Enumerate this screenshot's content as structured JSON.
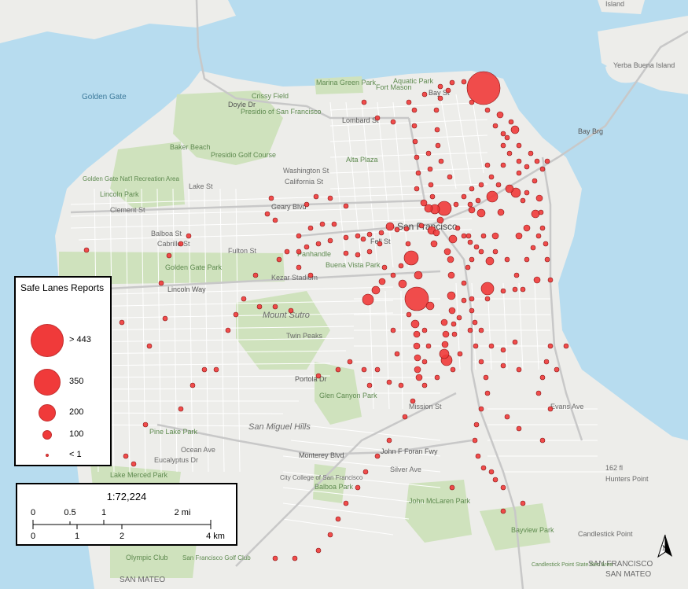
{
  "colors": {
    "water": "#b7dcef",
    "land": "#ededea",
    "park": "#cfe2bd",
    "street": "#ffffff",
    "highway": "#c8c8c8",
    "report": "#f03a3a",
    "report_stroke": "#8a1414"
  },
  "map_labels": {
    "golden_gate": "Golden Gate",
    "yerba_buena": "Yerba Buena Island",
    "treasure": "Island",
    "marina": "Marina Green Park",
    "fort_mason": "Fort Mason",
    "aquatic": "Aquatic Park",
    "crissy": "Crissy Field",
    "presidio": "Presidio of San Francisco",
    "baker": "Baker Beach",
    "presidio_golf": "Presidio Golf Course",
    "ggnra": "Golden Gate Nat'l Recreation Area",
    "lincoln_park": "Lincoln Park",
    "alta": "Alta Plaza",
    "sf": "San Francisco",
    "ggpark": "Golden Gate Park",
    "kezar": "Kezar Stadium",
    "panhandle": "Panhandle",
    "buena": "Buena Vista Park",
    "mount_sutro": "Mount Sutro",
    "twin_peaks": "Twin Peaks",
    "glen": "Glen Canyon Park",
    "san_miguel": "San Miguel Hills",
    "pine_lake": "Pine Lake Park",
    "ocean_ave": "Ocean Ave",
    "eucalyptus": "Eucalyptus Dr",
    "lake_merced": "Lake Merced Park",
    "ccsf": "City College of San Francisco",
    "balboa": "Balboa Park",
    "john_mclaren": "John McLaren Park",
    "hunters_point": "Hunters Point",
    "bayview": "Bayview Park",
    "candlestick": "Candlestick Point",
    "olympic": "Olympic Club",
    "sfgolf": "San Francisco Golf Club",
    "san_mateo_l": "SAN MATEO",
    "san_mateo_r": "SAN MATEO",
    "sf_county": "SAN FRANCISCO",
    "candlestick_rec": "Candlestick Point State Rec Area",
    "monterey": "Monterey Blvd",
    "jff": "John F Foran Fwy",
    "lincoln_way": "Lincoln Way",
    "geary": "Geary Blvd",
    "lombard": "Lombard St",
    "bay_st": "Bay St",
    "fell": "Fell St",
    "doyle": "Doyle Dr",
    "clement": "Clement St",
    "balboa_st": "Balboa St",
    "cabrillo": "Cabrillo St",
    "fulton": "Fulton St",
    "lake_st": "Lake St",
    "california": "California St",
    "washington": "Washington St",
    "portola": "Portola Dr",
    "silver": "Silver Ave",
    "evans": "Evans Ave",
    "bay_bridge": "Bay Brg",
    "mission_st": "Mission St",
    "162nd": "162 fl"
  },
  "report_points": [
    [
      615,
      112,
      21
    ],
    [
      530,
      380,
      15
    ],
    [
      565,
      265,
      9
    ],
    [
      523,
      328,
      9
    ],
    [
      620,
      367,
      8
    ],
    [
      468,
      381,
      7
    ],
    [
      626,
      250,
      7
    ],
    [
      568,
      458,
      7
    ],
    [
      553,
      266,
      6
    ],
    [
      496,
      288,
      5
    ],
    [
      565,
      450,
      6
    ],
    [
      656,
      245,
      6
    ],
    [
      612,
      271,
      5
    ],
    [
      528,
      412,
      5
    ],
    [
      547,
      389,
      5
    ],
    [
      655,
      165,
      5
    ],
    [
      681,
      272,
      5
    ],
    [
      549,
      293,
      5
    ],
    [
      574,
      376,
      5
    ],
    [
      532,
      350,
      5
    ],
    [
      576,
      304,
      5
    ],
    [
      623,
      332,
      5
    ],
    [
      545,
      265,
      5
    ],
    [
      683,
      356,
      4
    ],
    [
      512,
      361,
      5
    ],
    [
      478,
      369,
      5
    ],
    [
      486,
      358,
      4
    ],
    [
      648,
      240,
      5
    ],
    [
      636,
      146,
      4
    ],
    [
      530,
      425,
      4
    ],
    [
      530,
      440,
      4
    ],
    [
      531,
      455,
      4
    ],
    [
      531,
      470,
      4
    ],
    [
      533,
      480,
      4
    ],
    [
      566,
      438,
      4
    ],
    [
      567,
      425,
      4
    ],
    [
      565,
      410,
      4
    ],
    [
      575,
      395,
      4
    ],
    [
      574,
      350,
      4
    ],
    [
      573,
      330,
      4
    ],
    [
      569,
      320,
      4
    ],
    [
      552,
      310,
      4
    ],
    [
      555,
      296,
      4
    ],
    [
      560,
      280,
      4
    ],
    [
      539,
      258,
      4
    ],
    [
      600,
      267,
      4
    ],
    [
      637,
      270,
      4
    ],
    [
      630,
      300,
      4
    ],
    [
      660,
      300,
      4
    ],
    [
      670,
      290,
      4
    ],
    [
      686,
      252,
      4
    ],
    [
      640,
      210,
      3
    ],
    [
      660,
      220,
      3
    ],
    [
      680,
      230,
      3
    ],
    [
      620,
      210,
      3
    ],
    [
      600,
      240,
      3
    ],
    [
      590,
      250,
      3
    ],
    [
      580,
      260,
      3
    ],
    [
      530,
      240,
      3
    ],
    [
      532,
      220,
      3
    ],
    [
      530,
      200,
      3
    ],
    [
      528,
      180,
      3
    ],
    [
      527,
      160,
      3
    ],
    [
      527,
      140,
      3
    ],
    [
      545,
      195,
      3
    ],
    [
      547,
      215,
      3
    ],
    [
      548,
      235,
      3
    ],
    [
      550,
      250,
      3
    ],
    [
      536,
      287,
      3
    ],
    [
      517,
      291,
      3
    ],
    [
      505,
      292,
      3
    ],
    [
      485,
      296,
      3
    ],
    [
      470,
      298,
      3
    ],
    [
      455,
      300,
      3
    ],
    [
      440,
      302,
      3
    ],
    [
      420,
      306,
      3
    ],
    [
      405,
      310,
      3
    ],
    [
      390,
      314,
      3
    ],
    [
      380,
      320,
      3
    ],
    [
      470,
      320,
      3
    ],
    [
      455,
      324,
      3
    ],
    [
      440,
      322,
      3
    ],
    [
      483,
      310,
      3
    ],
    [
      462,
      304,
      3
    ],
    [
      519,
      310,
      3
    ],
    [
      510,
      338,
      3
    ],
    [
      500,
      350,
      3
    ],
    [
      489,
      340,
      3
    ],
    [
      577,
      412,
      3
    ],
    [
      578,
      425,
      3
    ],
    [
      590,
      382,
      3
    ],
    [
      600,
      380,
      3
    ],
    [
      620,
      380,
      3
    ],
    [
      640,
      370,
      3
    ],
    [
      655,
      368,
      3
    ],
    [
      665,
      368,
      3
    ],
    [
      700,
      356,
      3
    ],
    [
      696,
      330,
      3
    ],
    [
      694,
      310,
      3
    ],
    [
      690,
      290,
      3
    ],
    [
      688,
      270,
      3
    ],
    [
      685,
      300,
      3
    ],
    [
      678,
      315,
      3
    ],
    [
      670,
      330,
      3
    ],
    [
      657,
      350,
      3
    ],
    [
      645,
      330,
      3
    ],
    [
      630,
      320,
      3
    ],
    [
      612,
      320,
      3
    ],
    [
      600,
      330,
      3
    ],
    [
      595,
      340,
      3
    ],
    [
      590,
      360,
      3
    ],
    [
      584,
      404,
      3
    ],
    [
      600,
      395,
      3
    ],
    [
      598,
      420,
      3
    ],
    [
      605,
      440,
      3
    ],
    [
      612,
      460,
      3
    ],
    [
      618,
      480,
      3
    ],
    [
      620,
      500,
      3
    ],
    [
      612,
      520,
      3
    ],
    [
      606,
      540,
      3
    ],
    [
      604,
      560,
      3
    ],
    [
      608,
      580,
      3
    ],
    [
      615,
      595,
      3
    ],
    [
      625,
      600,
      3
    ],
    [
      630,
      610,
      3
    ],
    [
      640,
      620,
      3
    ],
    [
      645,
      530,
      3
    ],
    [
      660,
      545,
      3
    ],
    [
      690,
      560,
      3
    ],
    [
      700,
      440,
      3
    ],
    [
      695,
      460,
      3
    ],
    [
      690,
      480,
      3
    ],
    [
      685,
      500,
      3
    ],
    [
      660,
      470,
      3
    ],
    [
      640,
      465,
      3
    ],
    [
      625,
      440,
      3
    ],
    [
      612,
      420,
      3
    ],
    [
      604,
      410,
      3
    ],
    [
      585,
      450,
      3
    ],
    [
      576,
      470,
      3
    ],
    [
      556,
      480,
      3
    ],
    [
      540,
      490,
      3
    ],
    [
      525,
      510,
      3
    ],
    [
      515,
      530,
      3
    ],
    [
      495,
      560,
      3
    ],
    [
      480,
      580,
      3
    ],
    [
      465,
      600,
      3
    ],
    [
      455,
      620,
      3
    ],
    [
      440,
      640,
      3
    ],
    [
      430,
      660,
      3
    ],
    [
      420,
      680,
      3
    ],
    [
      405,
      700,
      3
    ],
    [
      375,
      710,
      3
    ],
    [
      350,
      710,
      3
    ],
    [
      405,
      478,
      3
    ],
    [
      430,
      470,
      3
    ],
    [
      445,
      460,
      3
    ],
    [
      463,
      470,
      3
    ],
    [
      480,
      470,
      3
    ],
    [
      470,
      490,
      3
    ],
    [
      495,
      486,
      3
    ],
    [
      510,
      490,
      3
    ],
    [
      505,
      450,
      3
    ],
    [
      500,
      420,
      3
    ],
    [
      520,
      400,
      3
    ],
    [
      540,
      420,
      3
    ],
    [
      545,
      440,
      3
    ],
    [
      540,
      460,
      3
    ],
    [
      463,
      130,
      3
    ],
    [
      480,
      150,
      3
    ],
    [
      500,
      155,
      3
    ],
    [
      520,
      130,
      3
    ],
    [
      540,
      120,
      3
    ],
    [
      560,
      110,
      3
    ],
    [
      575,
      105,
      3
    ],
    [
      590,
      104,
      3
    ],
    [
      640,
      185,
      3
    ],
    [
      648,
      195,
      3
    ],
    [
      660,
      205,
      3
    ],
    [
      670,
      212,
      3
    ],
    [
      690,
      215,
      3
    ],
    [
      696,
      205,
      3
    ],
    [
      645,
      175,
      3
    ],
    [
      625,
      225,
      3
    ],
    [
      634,
      235,
      3
    ],
    [
      612,
      235,
      3
    ],
    [
      608,
      255,
      3
    ],
    [
      582,
      290,
      3
    ],
    [
      590,
      300,
      3
    ],
    [
      598,
      308,
      3
    ],
    [
      606,
      314,
      3
    ],
    [
      615,
      300,
      3
    ],
    [
      345,
      252,
      3
    ],
    [
      340,
      272,
      3
    ],
    [
      350,
      280,
      3
    ],
    [
      380,
      300,
      3
    ],
    [
      395,
      290,
      3
    ],
    [
      410,
      285,
      3
    ],
    [
      425,
      285,
      3
    ],
    [
      440,
      262,
      3
    ],
    [
      420,
      252,
      3
    ],
    [
      402,
      250,
      3
    ],
    [
      390,
      260,
      3
    ],
    [
      230,
      310,
      3
    ],
    [
      240,
      300,
      3
    ],
    [
      215,
      325,
      3
    ],
    [
      110,
      318,
      3
    ],
    [
      155,
      410,
      3
    ],
    [
      210,
      405,
      3
    ],
    [
      310,
      380,
      3
    ],
    [
      330,
      390,
      3
    ],
    [
      350,
      390,
      3
    ],
    [
      370,
      395,
      3
    ],
    [
      325,
      350,
      3
    ],
    [
      355,
      330,
      3
    ],
    [
      365,
      320,
      3
    ],
    [
      380,
      340,
      3
    ],
    [
      395,
      350,
      3
    ],
    [
      160,
      580,
      3
    ],
    [
      170,
      590,
      3
    ],
    [
      185,
      540,
      3
    ],
    [
      230,
      520,
      3
    ],
    [
      245,
      490,
      3
    ],
    [
      260,
      470,
      3
    ],
    [
      275,
      470,
      3
    ],
    [
      290,
      420,
      3
    ],
    [
      300,
      400,
      3
    ],
    [
      205,
      360,
      3
    ],
    [
      190,
      440,
      3
    ],
    [
      575,
      620,
      3
    ],
    [
      640,
      650,
      3
    ],
    [
      665,
      640,
      3
    ],
    [
      700,
      520,
      3
    ],
    [
      708,
      470,
      3
    ],
    [
      720,
      440,
      3
    ],
    [
      655,
      435,
      3
    ],
    [
      640,
      445,
      3
    ],
    [
      596,
      300,
      3
    ],
    [
      598,
      260,
      3
    ],
    [
      572,
      225,
      3
    ],
    [
      561,
      205,
      3
    ],
    [
      557,
      185,
      3
    ],
    [
      556,
      165,
      3
    ],
    [
      555,
      140,
      3
    ],
    [
      560,
      125,
      3
    ],
    [
      570,
      115,
      3
    ],
    [
      600,
      130,
      3
    ],
    [
      620,
      140,
      3
    ],
    [
      630,
      160,
      3
    ],
    [
      640,
      170,
      3
    ],
    [
      650,
      155,
      3
    ],
    [
      660,
      185,
      3
    ],
    [
      675,
      195,
      3
    ],
    [
      683,
      205,
      3
    ],
    [
      665,
      255,
      3
    ],
    [
      670,
      245,
      3
    ]
  ],
  "legend": {
    "title": "Safe Lanes Reports",
    "items": [
      {
        "label": "> 443",
        "size": 21
      },
      {
        "label": "350",
        "size": 17
      },
      {
        "label": "200",
        "size": 11
      },
      {
        "label": "100",
        "size": 6
      },
      {
        "label": "< 1",
        "size": 2
      }
    ]
  },
  "scale": {
    "ratio": "1:72,224",
    "mi_labels": [
      "0",
      "0.5",
      "1",
      "2 mi"
    ],
    "km_labels": [
      "0",
      "1",
      "2",
      "4 km"
    ]
  },
  "north": {
    "label": "N"
  }
}
